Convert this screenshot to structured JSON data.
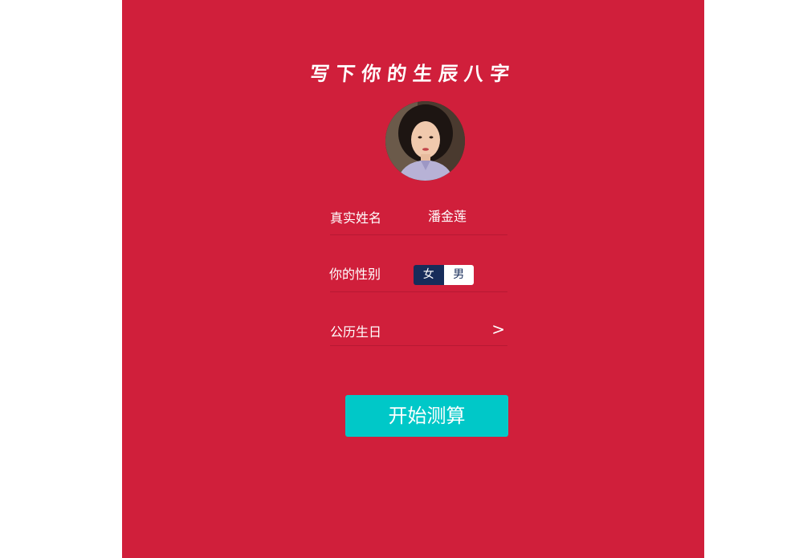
{
  "title": "写下你的生辰八字",
  "form": {
    "name_label": "真实姓名",
    "name_value": "潘金莲",
    "gender_label": "你的性别",
    "gender_options": [
      "女",
      "男"
    ],
    "gender_selected": "女",
    "birthday_label": "公历生日",
    "birthday_chevron": ">"
  },
  "start_button_label": "开始测算",
  "colors": {
    "panel_background": "#d01f3b",
    "toggle_active": "#172c5a",
    "button_accent": "#00c8c8"
  },
  "avatar": {
    "icon": "portrait-photo"
  }
}
